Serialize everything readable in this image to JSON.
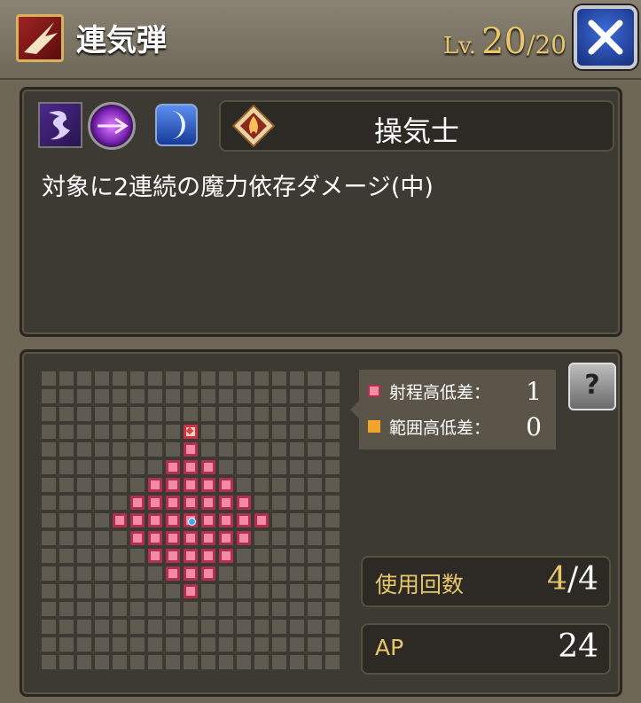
{
  "header": {
    "skill_name": "連気弾",
    "level_label": "Lv.",
    "level_current": "20",
    "level_max": "/20",
    "close_icon": "close-x-icon"
  },
  "skill": {
    "icons": [
      "dark-element-icon",
      "magic-orb-icon",
      "moon-icon"
    ],
    "job_icon": "flame-emblem-icon",
    "job_name": "操気士",
    "description": "対象に2連続の魔力依存ダメージ(中)"
  },
  "range": {
    "range_height_label": "射程高低差：",
    "range_height_value": "1",
    "area_height_label": "範囲高低差：",
    "area_height_value": "0",
    "help_label": "?"
  },
  "stats": {
    "uses_label": "使用回数",
    "uses_current": "4",
    "uses_max": "/4",
    "ap_label": "AP",
    "ap_value": "24"
  },
  "colors": {
    "range_fill": "#f58aa4",
    "area_fill": "#f2a52a",
    "accent_gold": "#e8c66a"
  }
}
